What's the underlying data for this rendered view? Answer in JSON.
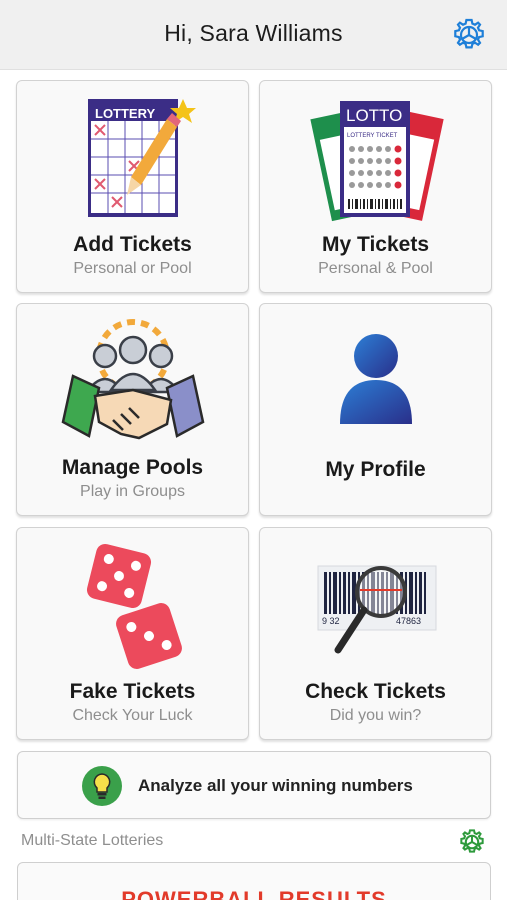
{
  "header": {
    "title": "Hi, Sara Williams",
    "settings_icon": "gear-icon"
  },
  "tiles": [
    {
      "title": "Add Tickets",
      "subtitle": "Personal or Pool",
      "icon": "lottery-ticket-pencil-icon",
      "art_text": "LOTTERY"
    },
    {
      "title": "My Tickets",
      "subtitle": "Personal & Pool",
      "icon": "lotto-tickets-icon",
      "art_text": "LOTTO",
      "art_subtext": "LOTTERY TICKET"
    },
    {
      "title": "Manage Pools",
      "subtitle": "Play in Groups",
      "icon": "handshake-group-icon"
    },
    {
      "title": "My Profile",
      "icon": "user-profile-icon"
    },
    {
      "title": "Fake Tickets",
      "subtitle": "Check Your Luck",
      "icon": "dice-icon"
    },
    {
      "title": "Check Tickets",
      "subtitle": "Did you win?",
      "icon": "barcode-magnifier-icon",
      "art_text": "9 32",
      "art_text2": "47863"
    }
  ],
  "analyze": {
    "label": "Analyze all your winning numbers",
    "icon": "lightbulb-icon"
  },
  "section": {
    "label": "Multi-State Lotteries",
    "settings_icon": "gear-icon"
  },
  "results": {
    "label": "POWERBALL RESULTS"
  },
  "colors": {
    "accent_blue": "#1e7fd8",
    "accent_green": "#2e9a3c",
    "powerball_red": "#e23a2a",
    "dice_red": "#ec4a5c"
  }
}
